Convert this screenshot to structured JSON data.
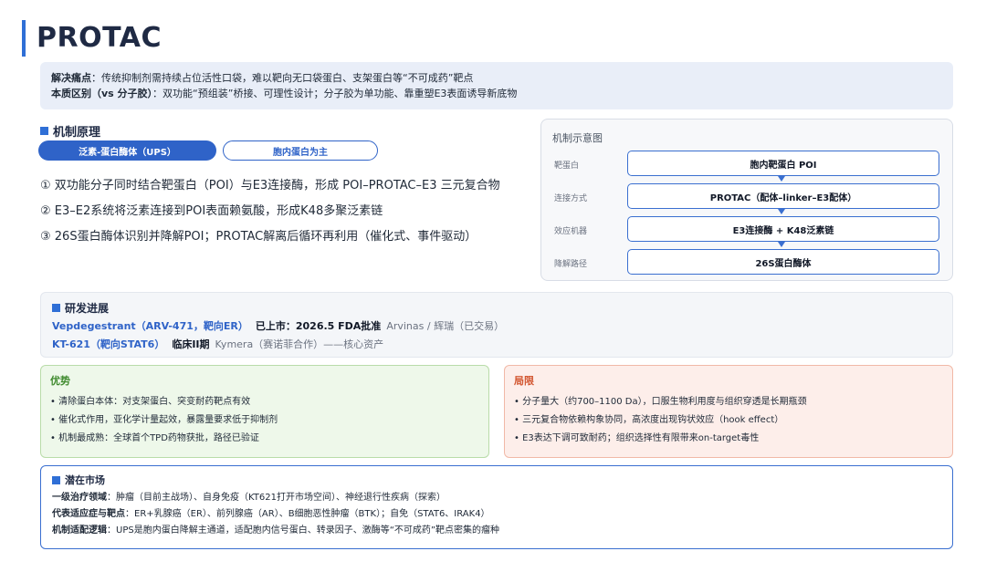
{
  "title": "PROTAC",
  "problem": {
    "pain_label": "解决痛点",
    "pain_text": "：传统抑制剂需持续占位活性口袋，难以靶向无口袋蛋白、支架蛋白等“不可成药”靶点",
    "diff_label": "本质区别（vs 分子胶）",
    "diff_text": "：双功能“预组装”桥接、可理性设计；分子胶为单功能、靠重塑E3表面诱导新底物"
  },
  "mechanism": {
    "heading": "机制原理",
    "pill_active": "泛素-蛋白酶体（UPS）",
    "pill_inactive": "胞内蛋白为主",
    "steps": [
      "① 双功能分子同时结合靶蛋白（POI）与E3连接酶，形成 POI–PROTAC–E3 三元复合物",
      "② E3–E2系统将泛素连接到POI表面赖氨酸，形成K48多聚泛素链",
      "③ 26S蛋白酶体识别并降解POI；PROTAC解离后循环再利用（催化式、事件驱动）"
    ]
  },
  "diagram": {
    "title": "机制示意图",
    "rows": [
      {
        "label": "靶蛋白",
        "box": "胞内靶蛋白 POI"
      },
      {
        "label": "连接方式",
        "box": "PROTAC（配体–linker–E3配体）"
      },
      {
        "label": "效应机器",
        "box": "E3连接酶 + K48泛素链"
      },
      {
        "label": "降解路径",
        "box": "26S蛋白酶体"
      }
    ]
  },
  "progress": {
    "heading": "研发进展",
    "items": [
      {
        "drug": "Vepdegestrant（ARV-471，靶向ER）",
        "stage": "已上市：2026.5 FDA批准",
        "partner": "Arvinas / 辉瑞（已交易）"
      },
      {
        "drug": "KT-621（靶向STAT6）",
        "stage": "临床II期",
        "partner": "Kymera（赛诺菲合作）——核心资产"
      }
    ]
  },
  "pros": {
    "heading": "优势",
    "items": [
      "• 清除蛋白本体：对支架蛋白、突变耐药靶点有效",
      "• 催化式作用，亚化学计量起效，暴露量要求低于抑制剂",
      "• 机制最成熟：全球首个TPD药物获批，路径已验证"
    ]
  },
  "cons": {
    "heading": "局限",
    "items": [
      "• 分子量大（约700–1100 Da），口服生物利用度与组织穿透是长期瓶颈",
      "• 三元复合物依赖构象协同，高浓度出现钩状效应（hook effect）",
      "• E3表达下调可致耐药；组织选择性有限带来on-target毒性"
    ]
  },
  "market": {
    "heading": "潜在市场",
    "lines": [
      {
        "label": "一级治疗领域",
        "text": "：肿瘤（目前主战场）、自身免疫（KT621打开市场空间）、神经退行性疾病（探索）"
      },
      {
        "label": "代表适应症与靶点",
        "text": "：ER+乳腺癌（ER）、前列腺癌（AR）、B细胞恶性肿瘤（BTK）；自免（STAT6、IRAK4）"
      },
      {
        "label": "机制适配逻辑",
        "text": "：UPS是胞内蛋白降解主通道，适配胞内信号蛋白、转录因子、激酶等“不可成药”靶点密集的瘤种"
      }
    ]
  },
  "colors": {
    "accent": "#2f6fd6",
    "pros": "#3f8a2e",
    "cons": "#d2552f"
  }
}
